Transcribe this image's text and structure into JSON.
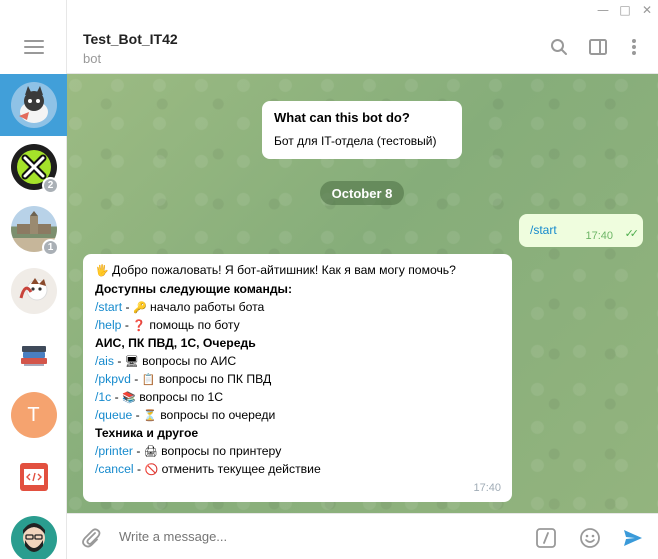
{
  "window": {
    "minimize": "—",
    "maximize": "□",
    "close": "✕"
  },
  "sidebar": {
    "menu_icon": "hamburger-icon",
    "chats": [
      {
        "name": "test-bot-it42",
        "active": true,
        "badge": ""
      },
      {
        "name": "x-app",
        "active": false,
        "badge": "2"
      },
      {
        "name": "channel-photo",
        "active": false,
        "badge": "1"
      },
      {
        "name": "cat-chat",
        "active": false,
        "badge": ""
      },
      {
        "name": "books-chat",
        "active": false,
        "badge": ""
      },
      {
        "name": "t-chat",
        "active": false,
        "badge": "",
        "letter": "T"
      },
      {
        "name": "code-chat",
        "active": false,
        "badge": ""
      },
      {
        "name": "hipster-chat",
        "active": false,
        "badge": ""
      }
    ]
  },
  "header": {
    "title": "Test_Bot_IT42",
    "subtitle": "bot",
    "icons": [
      "search-icon",
      "sidebar-toggle-icon",
      "more-icon"
    ]
  },
  "info_card": {
    "title": "What can this bot do?",
    "text": "Бот для IT-отдела (тестовый)"
  },
  "date_separator": "October 8",
  "outgoing": {
    "text": "/start",
    "time": "17:40"
  },
  "incoming": {
    "greeting_emoji": "🖐",
    "greeting": "Добро пожаловать! Я бот-айтишник! Как я вам могу помочь?",
    "commands_header": "Доступны следующие команды:",
    "start_cmd": "/start",
    "start_desc": "начало работы бота",
    "help_cmd": "/help",
    "help_desc": "помощь по боту",
    "group1": "АИС, ПК ПВД, 1С, Очередь",
    "ais_cmd": "/ais",
    "ais_desc": "вопросы по АИС",
    "pkpvd_cmd": "/pkpvd",
    "pkpvd_desc": "вопросы по ПК ПВД",
    "onec_cmd": "/1c",
    "onec_desc": "вопросы по 1С",
    "queue_cmd": "/queue",
    "queue_desc": "вопросы по очереди",
    "group2": "Техника и другое",
    "printer_cmd": "/printer",
    "printer_desc": "вопросы по принтеру",
    "cancel_cmd": "/cancel",
    "cancel_desc": "отменить текущее действие",
    "time": "17:40"
  },
  "composer": {
    "placeholder": "Write a message...",
    "icons": [
      "attach-icon",
      "bot-command-icon",
      "emoji-icon",
      "send-icon"
    ]
  },
  "colors": {
    "accent": "#419fd9",
    "link": "#168acd",
    "outgoing_bg": "#effdde",
    "chat_bg": "#89ae79"
  }
}
